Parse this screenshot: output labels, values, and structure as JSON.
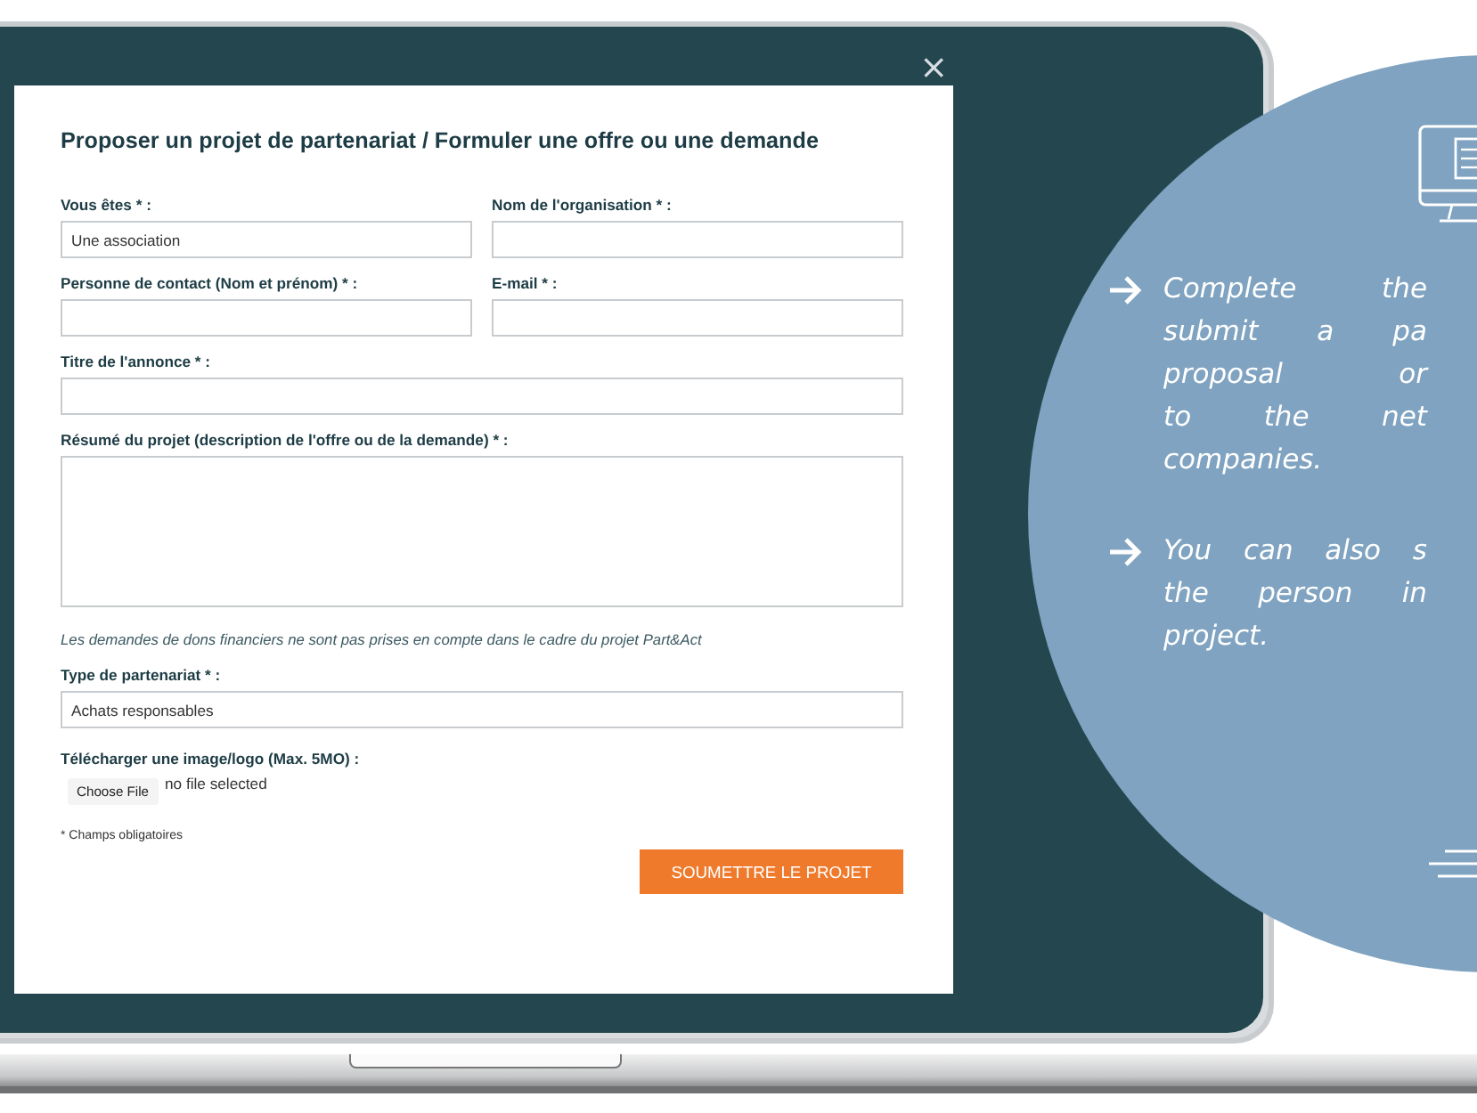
{
  "dialog": {
    "close": "×",
    "title": "Proposer un projet de partenariat / Formuler une offre ou une demande",
    "fields": [
      {
        "kind": "half",
        "label": "Vous êtes * :",
        "value": "Une association"
      },
      {
        "kind": "half",
        "label": "Nom de l'organisation * :"
      },
      {
        "kind": "half",
        "label": "Personne de contact (Nom et prénom) * :"
      },
      {
        "kind": "half",
        "label": "E-mail * :"
      },
      {
        "kind": "full",
        "label": "Titre de l'annonce * :"
      },
      {
        "kind": "textarea",
        "label": "Résumé du projet (description de l'offre ou de la demande) * :"
      },
      {
        "kind": "note",
        "label": "Les demandes de dons financiers ne sont pas prises en compte dans le cadre du projet Part&Act"
      },
      {
        "kind": "full",
        "label": "Type de partenariat * :",
        "value": "Achats responsables"
      }
    ],
    "upload": {
      "label": "Télécharger une image/logo (Max. 5MO) :",
      "button": "Choose File",
      "status": "no file selected"
    },
    "footnote": "* Champs obligatoires",
    "submit": "SOUMETTRE LE PROJET"
  },
  "callout": {
    "paragraphs": [
      {
        "lines": [
          "Complete the",
          "submit a pa",
          "proposal or",
          "to the net",
          "companies."
        ]
      },
      {
        "lines": [
          "You can also s",
          "the person in",
          "project."
        ]
      }
    ]
  }
}
